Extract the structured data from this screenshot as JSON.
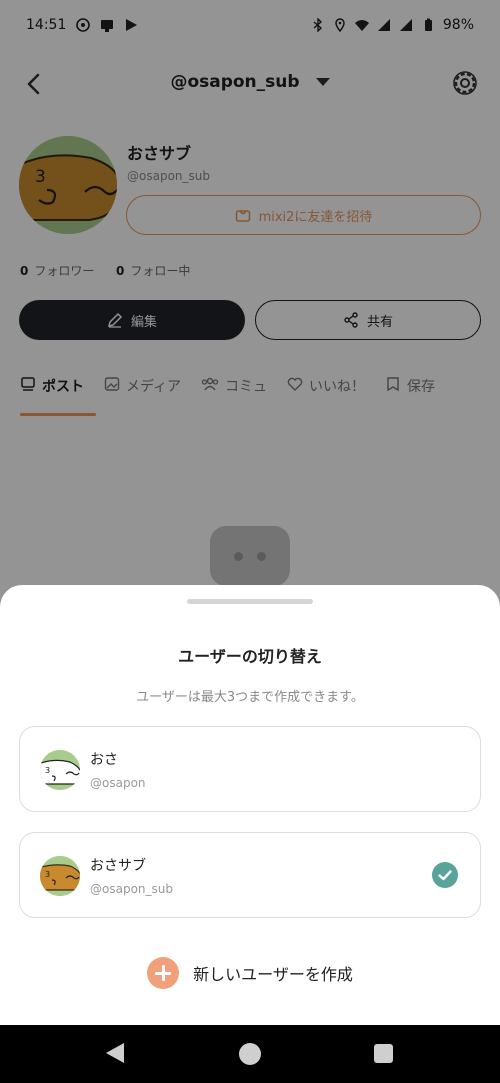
{
  "status_bar": {
    "time": "14:51",
    "battery": "98%"
  },
  "header": {
    "title": "@osapon_sub"
  },
  "profile": {
    "display_name": "おさサブ",
    "handle": "@osapon_sub",
    "invite_label": "mixi2に友達を招待",
    "followers_count": "0",
    "followers_label": "フォロワー",
    "following_count": "0",
    "following_label": "フォロー中",
    "edit_label": "編集",
    "share_label": "共有"
  },
  "tabs": [
    {
      "label": "ポスト",
      "active": true
    },
    {
      "label": "メディア"
    },
    {
      "label": "コミュ"
    },
    {
      "label": "いいね！"
    },
    {
      "label": "保存"
    }
  ],
  "sheet": {
    "title": "ユーザーの切り替え",
    "subtitle": "ユーザーは最大3つまで作成できます。",
    "accounts": [
      {
        "name": "おさ",
        "handle": "@osapon",
        "selected": false
      },
      {
        "name": "おさサブ",
        "handle": "@osapon_sub",
        "selected": true
      }
    ],
    "create_label": "新しいユーザーを作成"
  },
  "colors": {
    "accent": "#e8965a",
    "check": "#5aa39a",
    "dark_button": "#1f2329"
  },
  "icons": [
    "back-icon",
    "chevron-down-icon",
    "gear-icon",
    "gift-icon",
    "pencil-icon",
    "share-icon",
    "check-icon",
    "plus-icon"
  ]
}
